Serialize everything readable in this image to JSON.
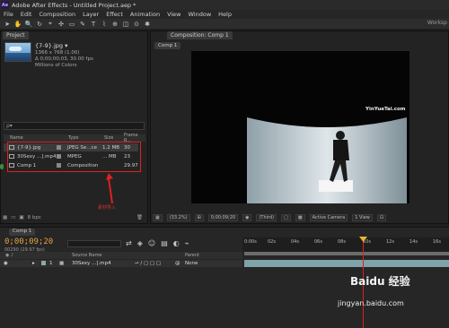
{
  "window": {
    "title": "Adobe After Effects - Untitled Project.aep *",
    "logo": "Ae"
  },
  "menu": [
    "File",
    "Edit",
    "Composition",
    "Layer",
    "Effect",
    "Animation",
    "View",
    "Window",
    "Help"
  ],
  "toolbar": {
    "workspace": "Worksp",
    "tools": [
      "selection-icon",
      "hand-icon",
      "zoom-icon",
      "rotate-icon",
      "camera-icon",
      "pan-behind-icon",
      "rectangle-icon",
      "pen-icon",
      "text-icon",
      "brush-icon",
      "clone-icon",
      "eraser-icon",
      "roto-icon",
      "puppet-icon"
    ]
  },
  "project": {
    "tab": "Project",
    "selected_name": "{7-9}.jpg ▾",
    "info": [
      "1366 x 768 (1.00)",
      "Δ 0;00;00;03, 30.00 fps",
      "Millions of Colors"
    ],
    "search_placeholder": "ρ▾",
    "columns": {
      "name": "Name",
      "type": "Type",
      "size": "Size",
      "frame_rate": "Frame R..."
    },
    "items": [
      {
        "name": "{7-9}.jpg",
        "type": "JPEG Se...ce",
        "size": "1.2 MB",
        "frame_rate": "30"
      },
      {
        "name": "30Sexy ...].mp4",
        "type": "MPEG",
        "size": "... MB",
        "frame_rate": "23"
      },
      {
        "name": "Comp 1",
        "type": "Composition",
        "size": "",
        "frame_rate": "29.97"
      }
    ],
    "annotation": "素材导入",
    "footer_bpc": "8 bpc",
    "annotation_color": "#e02020"
  },
  "composition": {
    "tab": "Composition: Comp 1",
    "subtab": "Comp 1",
    "watermark": "YinYueTai.com",
    "footer": {
      "zoom": "(33.2%)",
      "timecode": "0;00;09;20",
      "resolution": "(Third)",
      "camera": "Active Camera",
      "view": "1 View"
    }
  },
  "timeline": {
    "tab": "Comp 1",
    "timecode": "0;00;09;20",
    "fps": "00290 (29.97 fps)",
    "columns": {
      "source": "Source Name",
      "parent": "Parent"
    },
    "layer": {
      "index": "1",
      "name": "30Sexy ...].mp4",
      "parent": "None"
    },
    "ruler": [
      "0:00s",
      "02s",
      "04s",
      "06s",
      "08s",
      "10s",
      "12s",
      "14s",
      "16s"
    ]
  },
  "baidu": {
    "logo_text": "Baidu 经验",
    "url": "jingyan.baidu.com"
  }
}
